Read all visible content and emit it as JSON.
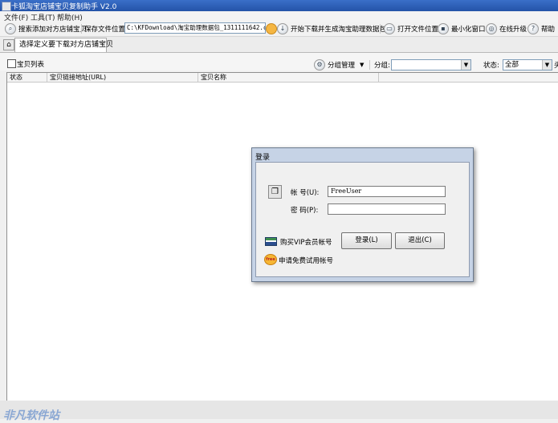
{
  "app": {
    "title": "卡狐淘宝店铺宝贝复制助手 V2.0"
  },
  "menu": {
    "file": "文件(F)",
    "tools": "工具(T)",
    "help": "帮助(H)"
  },
  "toolbar": {
    "search_add": "搜索添加对方店铺宝贝",
    "save_location_label": "保存文件位置:",
    "save_path": "C:\\KFDownload\\淘宝助理数据包_1311111642.csv",
    "start_download": "开始下载并生成淘宝助理数据包",
    "open_file_location": "打开文件位置",
    "minimize_window": "最小化窗口",
    "online_upgrade": "在线升级",
    "help": "帮助"
  },
  "tab": {
    "label": "选择定义要下载对方店铺宝贝"
  },
  "filter": {
    "item_list_label": "宝贝列表",
    "group_manage": "分组管理",
    "group_label": "分组:",
    "group_value": "",
    "status_label": "状态:",
    "status_value": "全部",
    "extra": "头"
  },
  "table": {
    "columns": [
      "状态",
      "宝贝链接地址(URL)",
      "宝贝名称"
    ]
  },
  "login": {
    "title": "登录",
    "account_label": "帐  号(U):",
    "account_value": "FreeUser",
    "password_label": "密  码(P):",
    "password_value": "",
    "buy_vip": "购买VIP会员帐号",
    "free_trial": "申请免费试用帐号",
    "free_badge": "free",
    "login_button": "登录(L)",
    "exit_button": "退出(C)"
  },
  "watermark": {
    "text": "非凡软件站"
  }
}
